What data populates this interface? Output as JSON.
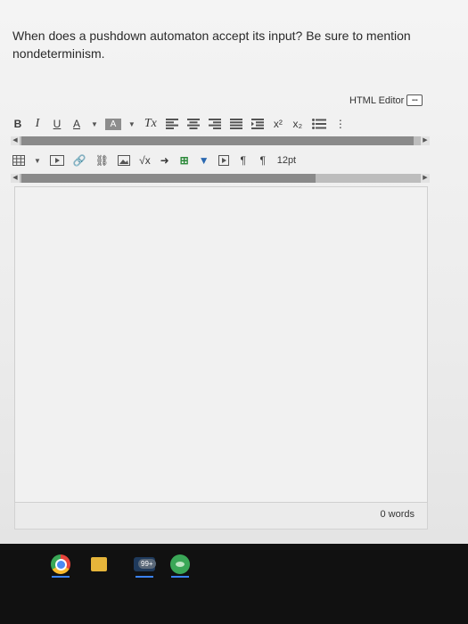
{
  "question": "When does a pushdown automaton accept its input? Be sure to mention nondeterminism.",
  "editor": {
    "html_editor_label": "HTML Editor",
    "toolbar1": {
      "bold": "B",
      "italic": "I",
      "underline": "U",
      "font_color": "A",
      "highlight": "A",
      "clear_format": "Tx",
      "superscript": "x²",
      "subscript": "x₂"
    },
    "toolbar2": {
      "font_size": "12pt"
    },
    "word_count": "0 words"
  },
  "taskbar": {
    "mail_badge": "99+"
  }
}
